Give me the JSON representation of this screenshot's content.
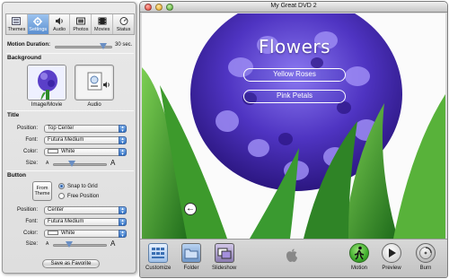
{
  "palette": {
    "tabs": [
      {
        "label": "Themes",
        "icon": "themes-icon"
      },
      {
        "label": "Settings",
        "icon": "settings-icon",
        "active": true
      },
      {
        "label": "Audio",
        "icon": "audio-icon"
      },
      {
        "label": "Photos",
        "icon": "photos-icon"
      },
      {
        "label": "Movies",
        "icon": "movies-icon"
      },
      {
        "label": "Status",
        "icon": "status-icon"
      }
    ],
    "motion_duration_label": "Motion Duration:",
    "motion_duration_value": "30 sec.",
    "motion_duration_fraction": 0.85,
    "background_heading": "Background",
    "image_movie_caption": "Image/Movie",
    "audio_caption": "Audio",
    "title_heading": "Title",
    "title_position_label": "Position:",
    "title_position_value": "Top Center",
    "title_font_label": "Font:",
    "title_font_value": "Futura Medium",
    "title_color_label": "Color:",
    "title_color_value": "White",
    "title_size_label": "Size:",
    "title_size_fraction": 0.35,
    "button_heading": "Button",
    "from_theme_label": "From Theme",
    "snap_to_grid_label": "Snap to Grid",
    "free_position_label": "Free Position",
    "button_position_label": "Position:",
    "button_position_value": "Center",
    "button_font_label": "Font:",
    "button_font_value": "Futura Medium",
    "button_color_label": "Color:",
    "button_color_value": "White",
    "button_size_label": "Size:",
    "button_size_fraction": 0.3,
    "size_small_glyph": "A",
    "size_large_glyph": "A",
    "save_favorite_label": "Save as Favorite"
  },
  "window": {
    "title": "My Great DVD 2",
    "menu_title": "Flowers",
    "buttons": [
      "Yellow Roses",
      "Pink Petals"
    ],
    "back_glyph": "←"
  },
  "toolbar": {
    "items": [
      {
        "label": "Customize",
        "icon": "customize-icon"
      },
      {
        "label": "Folder",
        "icon": "folder-icon"
      },
      {
        "label": "Slideshow",
        "icon": "slideshow-icon"
      },
      {
        "label": "Motion",
        "icon": "motion-icon"
      },
      {
        "label": "Preview",
        "icon": "preview-icon"
      },
      {
        "label": "Burn",
        "icon": "burn-icon"
      }
    ]
  },
  "colors": {
    "accent": "#5b8fd0",
    "motion_green": "#3fae2c",
    "flower_purple": "#5a3fc8"
  }
}
